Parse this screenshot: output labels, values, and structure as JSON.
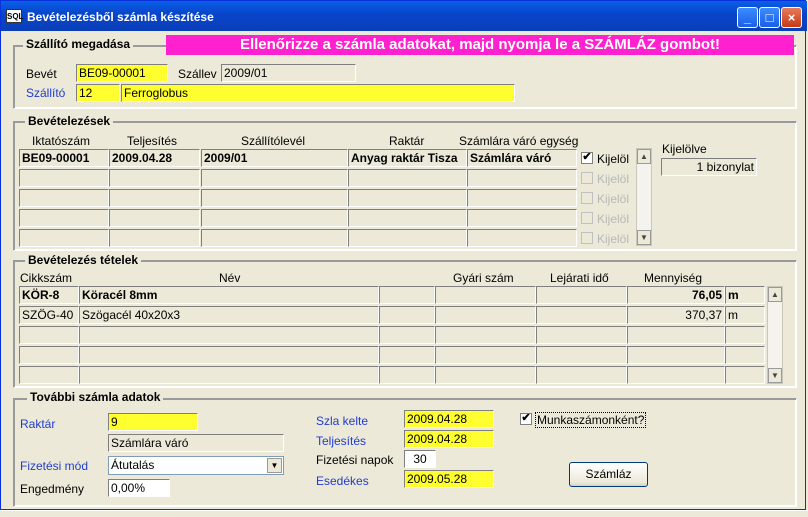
{
  "window": {
    "title": "Bevételezésből számla készítése",
    "app_icon": "app-icon"
  },
  "banner": "Ellenőrizze a számla adatokat, majd nyomja le a SZÁMLÁZ gombot!",
  "supplier": {
    "group_title": "Szállító megadása",
    "bevet_label": "Bevét",
    "bevet_value": "BE09-00001",
    "szallev_label": "Szállev",
    "szallev_value": "2009/01",
    "szallito_label": "Szállító",
    "szallito_code": "12",
    "szallito_name": "Ferroglobus"
  },
  "receipts": {
    "group_title": "Bevételezések",
    "headers": [
      "Iktatószám",
      "Teljesítés",
      "Szállítólevél",
      "Raktár",
      "Számlára váró egység"
    ],
    "rows": [
      {
        "iktato": "BE09-00001",
        "teljesites": "2009.04.28",
        "szallitolevel": "2009/01",
        "raktar": "Anyag raktár Tisza",
        "egyseg": "Számlára váró",
        "check_label": "Kijelöl",
        "checked": "✔"
      },
      {
        "iktato": "",
        "teljesites": "",
        "szallitolevel": "",
        "raktar": "",
        "egyseg": "",
        "check_label": "Kijelöl",
        "checked": ""
      },
      {
        "iktato": "",
        "teljesites": "",
        "szallitolevel": "",
        "raktar": "",
        "egyseg": "",
        "check_label": "Kijelöl",
        "checked": ""
      },
      {
        "iktato": "",
        "teljesites": "",
        "szallitolevel": "",
        "raktar": "",
        "egyseg": "",
        "check_label": "Kijelöl",
        "checked": ""
      },
      {
        "iktato": "",
        "teljesites": "",
        "szallitolevel": "",
        "raktar": "",
        "egyseg": "",
        "check_label": "Kijelöl",
        "checked": ""
      }
    ],
    "selected_label": "Kijelölve",
    "selected_value": "1 bizonylat"
  },
  "items": {
    "group_title": "Bevételezés tételek",
    "headers": [
      "Cikkszám",
      "Név",
      "Gyári szám",
      "Lejárati idő",
      "Mennyiség"
    ],
    "rows": [
      {
        "cikk": "KÖR-8",
        "nev": "Köracél 8mm",
        "gyari": "",
        "lejarat": "",
        "menny": "76,05",
        "me": "m",
        "bold": true
      },
      {
        "cikk": "SZÖG-40",
        "nev": "Szögacél 40x20x3",
        "gyari": "",
        "lejarat": "",
        "menny": "370,37",
        "me": "m",
        "bold": false
      },
      {
        "cikk": "",
        "nev": "",
        "gyari": "",
        "lejarat": "",
        "menny": "",
        "me": "",
        "bold": false
      },
      {
        "cikk": "",
        "nev": "",
        "gyari": "",
        "lejarat": "",
        "menny": "",
        "me": "",
        "bold": false
      },
      {
        "cikk": "",
        "nev": "",
        "gyari": "",
        "lejarat": "",
        "menny": "",
        "me": "",
        "bold": false
      }
    ]
  },
  "invoice": {
    "group_title": "További számla adatok",
    "raktar_label": "Raktár",
    "raktar_value": "9",
    "raktar_name": "Számlára váró",
    "fizmod_label": "Fizetési mód",
    "fizmod_value": "Átutalás",
    "engedmeny_label": "Engedmény",
    "engedmeny_value": "0,00%",
    "szla_kelte_label": "Szla kelte",
    "szla_kelte_value": "2009.04.28",
    "teljesites_label": "Teljesítés",
    "teljesites_value": "2009.04.28",
    "fiz_napok_label": "Fizetési napok",
    "fiz_napok_value": "30",
    "esedekes_label": "Esedékes",
    "esedekes_value": "2009.05.28",
    "munkaszam_label": "Munkaszámonként?",
    "munkaszam_checked": "✔",
    "szamlaz_button": "Számláz"
  },
  "colors": {
    "highlight": "#ffff30",
    "banner": "#ff20d0",
    "link_blue": "#1f3ccf",
    "titlebar": "#0844c9"
  }
}
